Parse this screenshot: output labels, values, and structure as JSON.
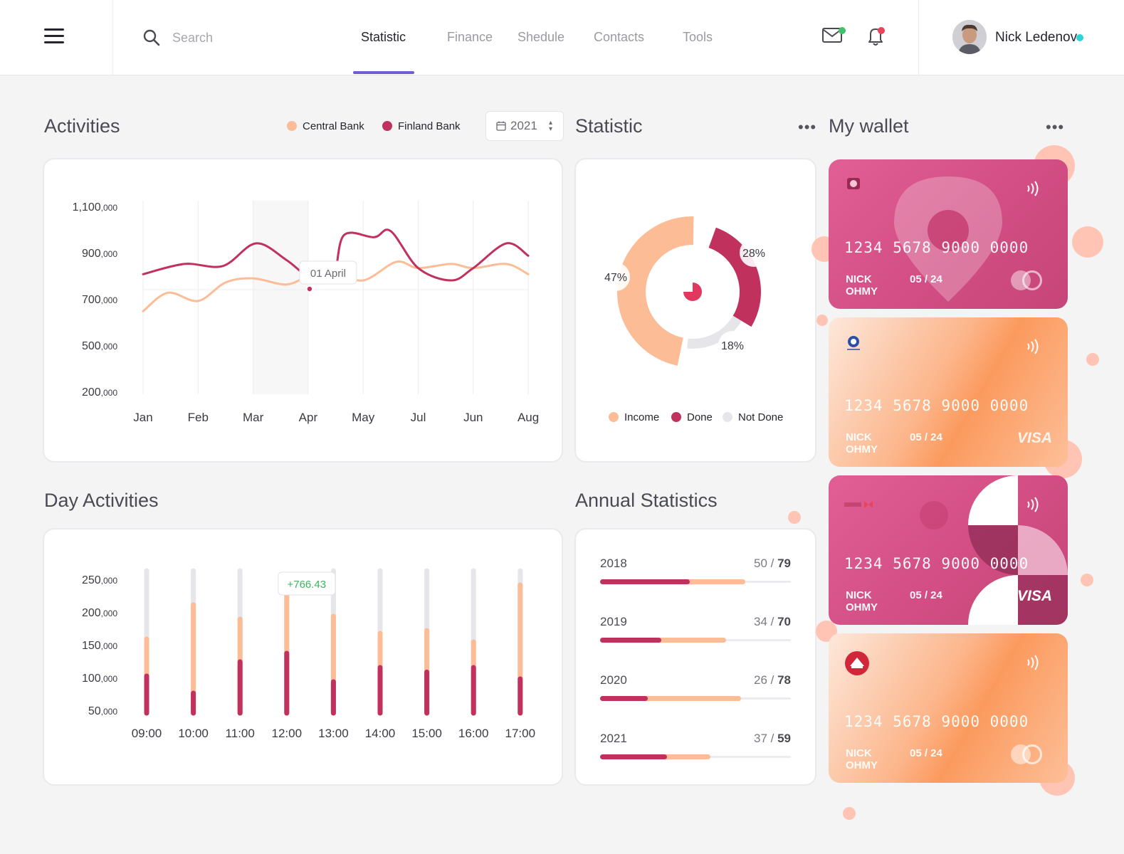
{
  "header": {
    "search_placeholder": "Search",
    "tabs": [
      {
        "label": "Statistic",
        "active": true
      },
      {
        "label": "Finance",
        "active": false
      },
      {
        "label": "Shedule",
        "active": false
      },
      {
        "label": "Contacts",
        "active": false
      },
      {
        "label": "Tools",
        "active": false
      }
    ],
    "user_name": "Nick Ledenov",
    "icons": [
      "menu-icon",
      "search-icon",
      "mail-icon",
      "bell-icon"
    ],
    "colors": {
      "accent": "#6b5fd3",
      "online": "#2bd4d8",
      "mail_badge": "#3fc26b",
      "bell_badge": "#e8455c"
    }
  },
  "activities": {
    "title": "Activities",
    "legend": [
      {
        "label": "Central Bank",
        "color": "#fbbc96"
      },
      {
        "label": "Finland Bank",
        "color": "#c0315e"
      }
    ],
    "year": "2021",
    "tooltip": "01 April"
  },
  "statistic": {
    "title": "Statistic",
    "more": "•••",
    "legend": [
      {
        "label": "Income",
        "color": "#fbbc96"
      },
      {
        "label": "Done",
        "color": "#c0315e"
      },
      {
        "label": "Not Done",
        "color": "#e6e6ea"
      }
    ]
  },
  "day_activities": {
    "title": "Day Activities",
    "tooltip": "+766.43"
  },
  "annual": {
    "title": "Annual Statistics",
    "rows": [
      {
        "year": "2018",
        "done": "50",
        "total": "79",
        "bar_done": 0.47,
        "bar_income": 0.76
      },
      {
        "year": "2019",
        "done": "34",
        "total": "70",
        "bar_done": 0.32,
        "bar_income": 0.66
      },
      {
        "year": "2020",
        "done": "26",
        "total": "78",
        "bar_done": 0.25,
        "bar_income": 0.74
      },
      {
        "year": "2021",
        "done": "37",
        "total": "59",
        "bar_done": 0.35,
        "bar_income": 0.58
      }
    ]
  },
  "wallet": {
    "title": "My wallet",
    "more": "•••",
    "cards": [
      {
        "number": "1234  5678  9000  0000",
        "holder": "NICK OHMY",
        "expiry": "05 / 24",
        "brand": "",
        "style": "pink"
      },
      {
        "number": "1234  5678  9000  0000",
        "holder": "NICK OHMY",
        "expiry": "05 / 24",
        "brand": "VISA",
        "style": "peach"
      },
      {
        "number": "1234  5678  9000  0000",
        "holder": "NICK OHMY",
        "expiry": "05 / 24",
        "brand": "VISA",
        "style": "pink"
      },
      {
        "number": "1234  5678  9000  0000",
        "holder": "NICK OHMY",
        "expiry": "05 / 24",
        "brand": "",
        "style": "peach"
      }
    ]
  },
  "chart_data": [
    {
      "type": "line",
      "title": "Activities",
      "categories": [
        "Jan",
        "Feb",
        "Mar",
        "Apr",
        "May",
        "Jul",
        "Jun",
        "Aug"
      ],
      "y_ticks": [
        {
          "main": "1,100",
          "sub": ",000"
        },
        {
          "main": "900",
          "sub": ",000"
        },
        {
          "main": "700",
          "sub": ",000"
        },
        {
          "main": "500",
          "sub": ",000"
        },
        {
          "main": "200",
          "sub": ",000"
        }
      ],
      "ylim": [
        200000,
        1100000
      ],
      "grid": "vertical",
      "highlight_category": "Mar",
      "series": [
        {
          "name": "Central Bank",
          "color": "#fbbc96",
          "x": [
            0,
            0.45,
            1,
            1.5,
            2,
            2.6,
            3,
            3.45,
            4,
            4.6,
            5,
            5.6,
            6,
            6.6,
            7
          ],
          "values": [
            590000,
            680000,
            640000,
            730000,
            750000,
            720000,
            760000,
            780000,
            740000,
            830000,
            800000,
            820000,
            800000,
            820000,
            770000
          ]
        },
        {
          "name": "Finland Bank",
          "color": "#c0315e",
          "x": [
            0,
            0.75,
            1.45,
            2.05,
            2.6,
            3.05,
            3.45,
            3.65,
            4.2,
            4.5,
            5,
            5.6,
            6,
            6.6,
            7
          ],
          "values": [
            770000,
            820000,
            810000,
            920000,
            840000,
            750000,
            750000,
            960000,
            950000,
            980000,
            800000,
            740000,
            800000,
            920000,
            860000
          ]
        }
      ],
      "tooltip": {
        "category": "Apr",
        "label": "01 April"
      }
    },
    {
      "type": "pie",
      "title": "Statistic",
      "slices": [
        {
          "label": "Income",
          "value": 47,
          "display": "47%",
          "color": "#fbbc96"
        },
        {
          "label": "Done",
          "value": 28,
          "display": "28%",
          "color": "#c0315e"
        },
        {
          "label": "Not Done",
          "value": 18,
          "display": "18%",
          "color": "#e6e6ea"
        }
      ]
    },
    {
      "type": "bar",
      "title": "Day Activities",
      "categories": [
        "09:00",
        "10:00",
        "11:00",
        "12:00",
        "13:00",
        "14:00",
        "15:00",
        "16:00",
        "17:00"
      ],
      "y_ticks": [
        {
          "main": "250",
          "sub": ",000"
        },
        {
          "main": "200",
          "sub": ",000"
        },
        {
          "main": "150",
          "sub": ",000"
        },
        {
          "main": "100",
          "sub": ",000"
        },
        {
          "main": "50",
          "sub": ",000"
        }
      ],
      "ylim": [
        0,
        250000
      ],
      "series": [
        {
          "name": "total",
          "color": "#e6e6ea",
          "values": [
            250000,
            250000,
            250000,
            215000,
            250000,
            250000,
            250000,
            250000,
            250000
          ]
        },
        {
          "name": "income",
          "color": "#fbbc96",
          "values": [
            130000,
            190000,
            165000,
            215000,
            170000,
            140000,
            145000,
            125000,
            225000
          ]
        },
        {
          "name": "done",
          "color": "#c0315e",
          "values": [
            65000,
            35000,
            90000,
            105000,
            55000,
            80000,
            72000,
            80000,
            60000
          ]
        }
      ],
      "tooltip": {
        "category": "12:00",
        "label": "+766.43"
      }
    }
  ]
}
